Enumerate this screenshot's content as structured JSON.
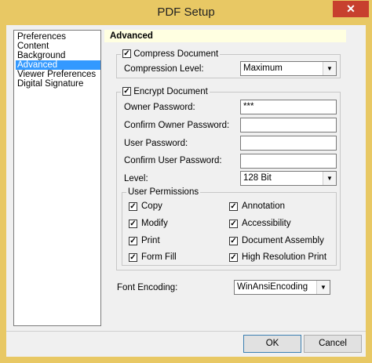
{
  "window": {
    "title": "PDF Setup",
    "close_glyph": "✕"
  },
  "nav": {
    "items": [
      {
        "label": "Preferences",
        "selected": false
      },
      {
        "label": "Content",
        "selected": false
      },
      {
        "label": "Background",
        "selected": false
      },
      {
        "label": "Advanced",
        "selected": true
      },
      {
        "label": "Viewer Preferences",
        "selected": false
      },
      {
        "label": "Digital Signature",
        "selected": false
      }
    ]
  },
  "panel": {
    "header": "Advanced"
  },
  "compress": {
    "checkbox_label": "Compress Document",
    "checked": true,
    "level_label": "Compression Level:",
    "level_value": "Maximum"
  },
  "encrypt": {
    "checkbox_label": "Encrypt Document",
    "checked": true,
    "owner_password_label": "Owner Password:",
    "owner_password_value": "***",
    "confirm_owner_label": "Confirm Owner Password:",
    "confirm_owner_value": "",
    "user_password_label": "User Password:",
    "user_password_value": "",
    "confirm_user_label": "Confirm User Password:",
    "confirm_user_value": "",
    "level_label": "Level:",
    "level_value": "128 Bit"
  },
  "permissions": {
    "legend": "User Permissions",
    "items": [
      {
        "label": "Copy",
        "checked": true
      },
      {
        "label": "Annotation",
        "checked": true
      },
      {
        "label": "Modify",
        "checked": true
      },
      {
        "label": "Accessibility",
        "checked": true
      },
      {
        "label": "Print",
        "checked": true
      },
      {
        "label": "Document Assembly",
        "checked": true
      },
      {
        "label": "Form Fill",
        "checked": true
      },
      {
        "label": "High Resolution Print",
        "checked": true
      }
    ]
  },
  "font_encoding": {
    "label": "Font Encoding:",
    "value": "WinAnsiEncoding"
  },
  "buttons": {
    "ok": "OK",
    "cancel": "Cancel"
  },
  "colors": {
    "title_bar": "#e8c864",
    "selection": "#3399ff",
    "header_bg": "#ffffe1",
    "close_button": "#c7402e"
  }
}
